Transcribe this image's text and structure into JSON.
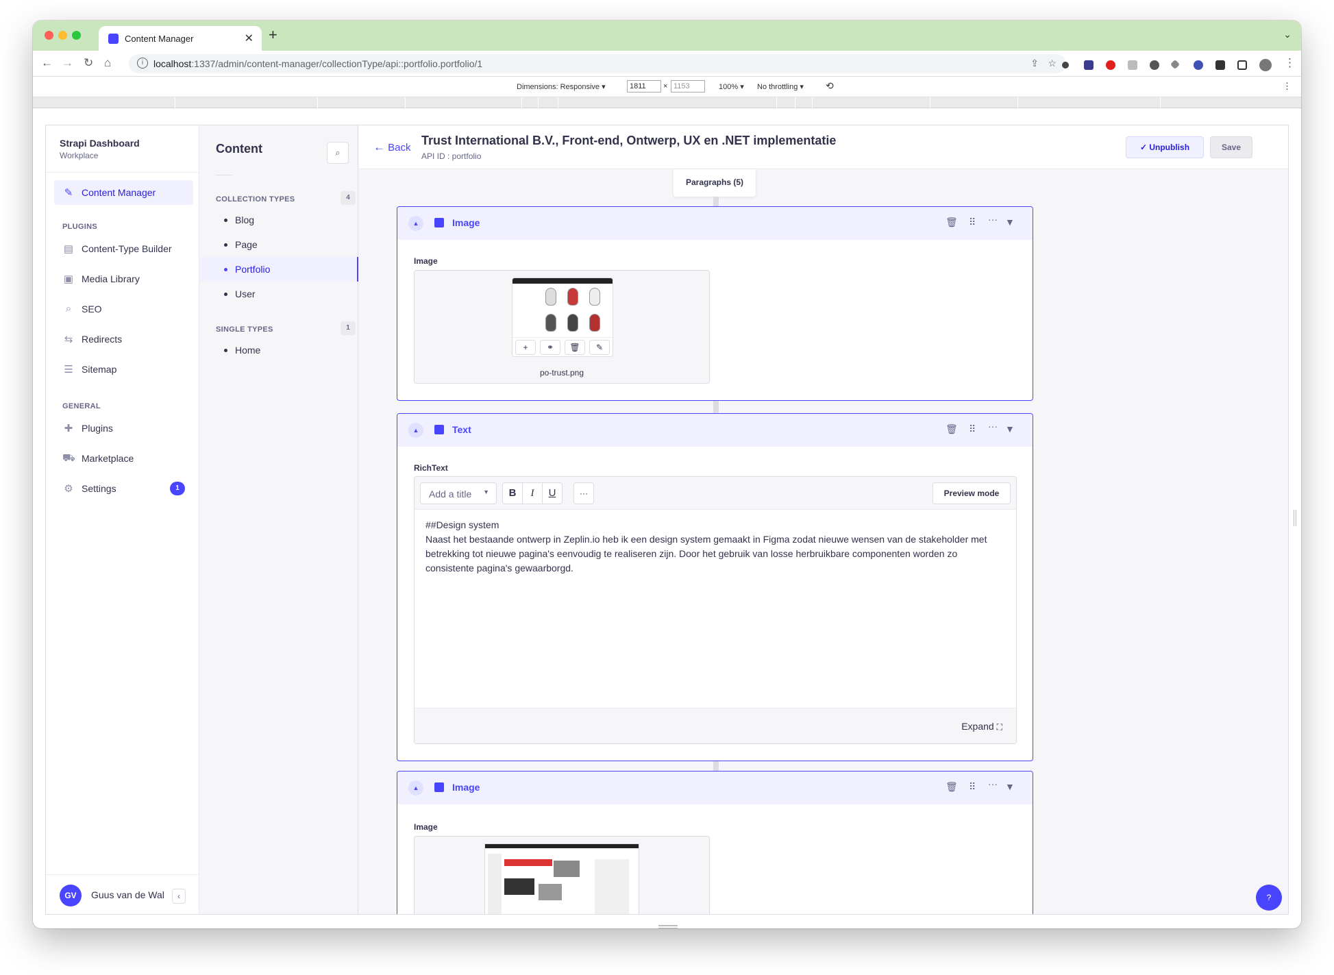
{
  "browser": {
    "tab_title": "Content Manager",
    "url_host": "localhost",
    "url_path": ":1337/admin/content-manager/collectionType/api::portfolio.portfolio/1",
    "devtools": {
      "dimensions_label": "Dimensions: Responsive",
      "width": "1811",
      "height_placeholder": "1153",
      "times": "×",
      "zoom": "100%",
      "throttling": "No throttling"
    }
  },
  "sidebar": {
    "brand_title": "Strapi Dashboard",
    "brand_subtitle": "Workplace",
    "content_manager": "Content Manager",
    "plugins_heading": "PLUGINS",
    "plugins": [
      "Content-Type Builder",
      "Media Library",
      "SEO",
      "Redirects",
      "Sitemap"
    ],
    "general_heading": "GENERAL",
    "general": [
      "Plugins",
      "Marketplace",
      "Settings"
    ],
    "settings_badge": "1",
    "user_initials": "GV",
    "user_name": "Guus van de Wal"
  },
  "subnav": {
    "title": "Content",
    "collection_heading": "COLLECTION TYPES",
    "collection_count": "4",
    "collection_items": [
      "Blog",
      "Page",
      "Portfolio",
      "User"
    ],
    "single_heading": "SINGLE TYPES",
    "single_count": "1",
    "single_items": [
      "Home"
    ]
  },
  "header": {
    "back": "Back",
    "title": "Trust International B.V., Front-end, Ontwerp, UX en .NET implementatie",
    "api_id": "API ID : portfolio",
    "unpublish": "Unpublish",
    "save": "Save"
  },
  "paragraphs_label": "Paragraphs (5)",
  "components": [
    {
      "name": "Image",
      "field_label": "Image",
      "file_name": "po-trust.png"
    },
    {
      "name": "Text",
      "field_label": "RichText",
      "title_select": "Add a title",
      "bold": "B",
      "italic": "I",
      "underline": "U",
      "more": "···",
      "preview_mode": "Preview mode",
      "content_heading": "##Design system",
      "content_body": "Naast het bestaande ontwerp in Zeplin.io heb ik een design system gemaakt in Figma zodat nieuwe wensen van de stakeholder met betrekking tot nieuwe pagina's eenvoudig te realiseren zijn. Door het gebruik van losse herbruikbare componenten worden zo consistente pagina's gewaarborgd.",
      "expand": "Expand"
    },
    {
      "name": "Image",
      "field_label": "Image"
    }
  ],
  "help_button": "?",
  "colors": {
    "primary": "#4945ff",
    "primary_light": "#f0f0ff",
    "tab_bar": "#c9e6be",
    "neutral_bg": "#f6f6f9"
  }
}
